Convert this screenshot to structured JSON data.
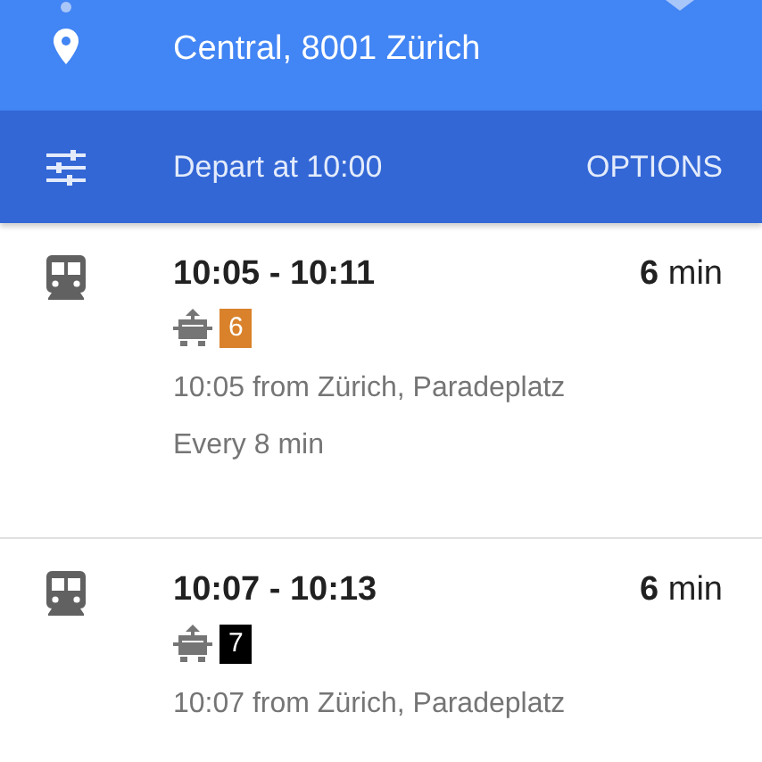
{
  "destination": {
    "label": "Central, 8001 Zürich"
  },
  "options_bar": {
    "label": "Depart at 10:00",
    "button": "OPTIONS"
  },
  "routes": [
    {
      "time": "10:05 - 10:11",
      "duration": "**6** min",
      "line": "6",
      "color": "#d9822b",
      "departure": "10:05 from Zürich, Paradeplatz",
      "frequency": "Every 8 min"
    },
    {
      "time": "10:07 - 10:13",
      "duration": "**6** min",
      "line": "7",
      "color": "#000000",
      "departure": "10:07 from Zürich, Paradeplatz"
    }
  ]
}
